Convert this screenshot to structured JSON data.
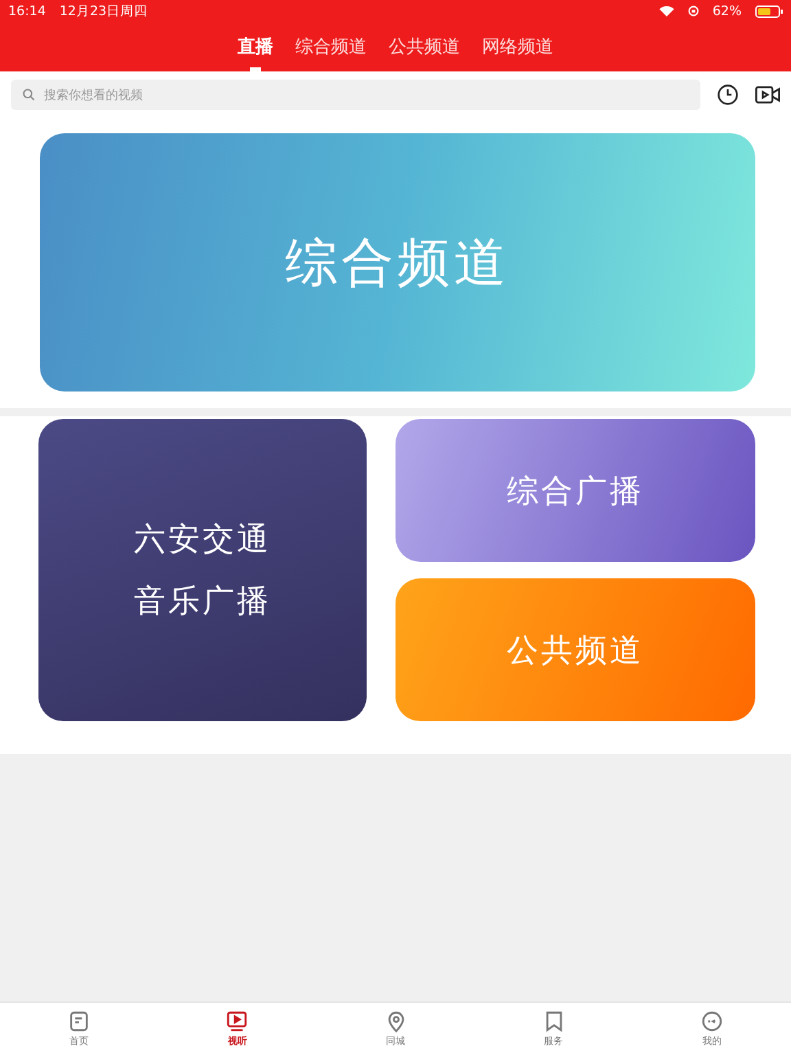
{
  "status_bar": {
    "time": "16:14",
    "date": "12月23日周四",
    "battery": "62%"
  },
  "tabs": [
    {
      "label": "直播",
      "selected": true
    },
    {
      "label": "综合频道",
      "selected": false
    },
    {
      "label": "公共频道",
      "selected": false
    },
    {
      "label": "网络频道",
      "selected": false
    }
  ],
  "search": {
    "placeholder": "搜索你想看的视频"
  },
  "banner": {
    "label": "综合频道"
  },
  "cards": [
    {
      "lines": [
        "六安交通",
        "音乐广播"
      ],
      "kind": "tall"
    },
    {
      "lines": [
        "综合广播"
      ],
      "kind": "purple"
    },
    {
      "lines": [
        "公共频道"
      ],
      "kind": "orange"
    }
  ],
  "nav": [
    {
      "label": "首页",
      "kind": "home",
      "selected": false
    },
    {
      "label": "视听",
      "kind": "video",
      "selected": true
    },
    {
      "label": "同城",
      "kind": "pin",
      "selected": false
    },
    {
      "label": "服务",
      "kind": "bookmark",
      "selected": false
    },
    {
      "label": "我的",
      "kind": "face",
      "selected": false
    }
  ]
}
